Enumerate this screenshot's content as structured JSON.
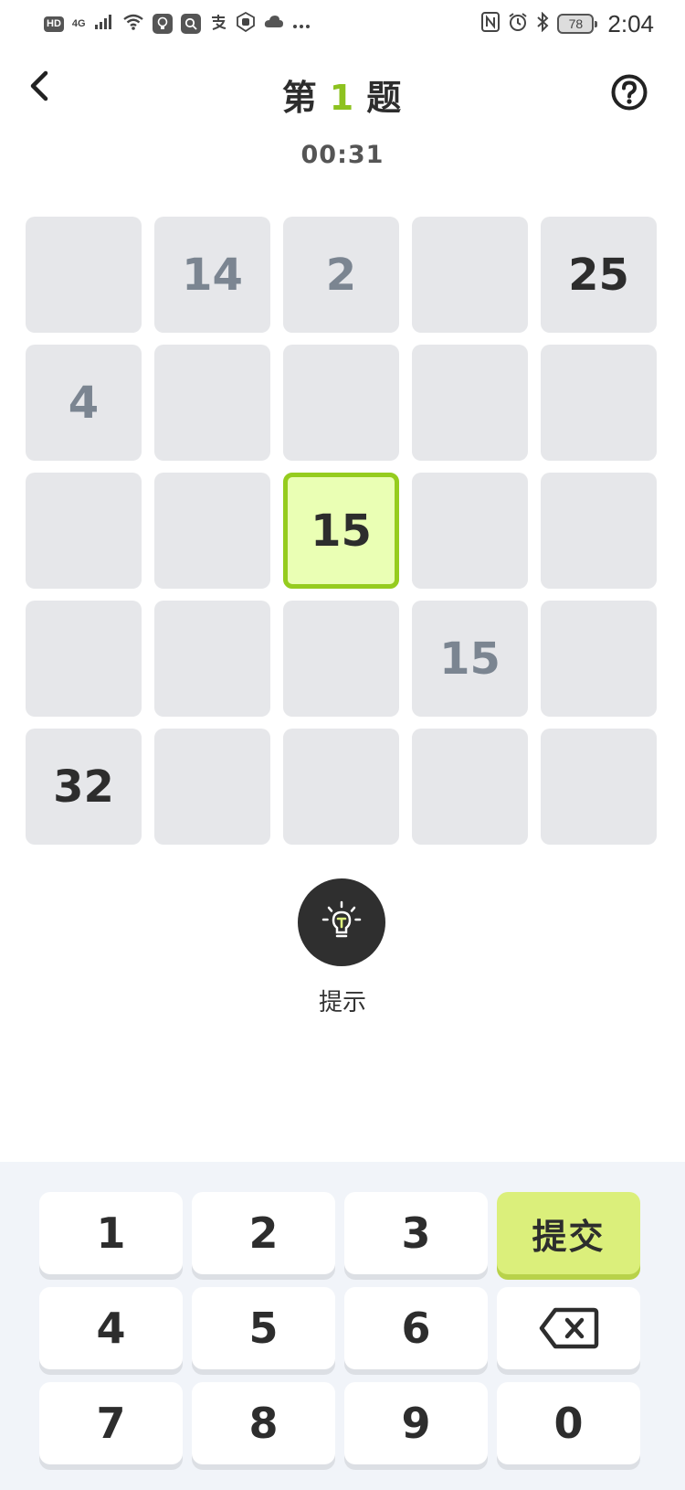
{
  "status_bar": {
    "hd": "HD",
    "network": "4G",
    "battery": "78",
    "time": "2:04"
  },
  "header": {
    "title_prefix": "第",
    "question_number": "1",
    "title_suffix": "题",
    "timer": "00:31"
  },
  "grid": {
    "rows": [
      [
        {
          "value": "",
          "kind": "empty"
        },
        {
          "value": "14",
          "kind": "user"
        },
        {
          "value": "2",
          "kind": "user"
        },
        {
          "value": "",
          "kind": "empty"
        },
        {
          "value": "25",
          "kind": "given"
        }
      ],
      [
        {
          "value": "4",
          "kind": "user"
        },
        {
          "value": "",
          "kind": "empty"
        },
        {
          "value": "",
          "kind": "empty"
        },
        {
          "value": "",
          "kind": "empty"
        },
        {
          "value": "",
          "kind": "empty"
        }
      ],
      [
        {
          "value": "",
          "kind": "empty"
        },
        {
          "value": "",
          "kind": "empty"
        },
        {
          "value": "15",
          "kind": "selected"
        },
        {
          "value": "",
          "kind": "empty"
        },
        {
          "value": "",
          "kind": "empty"
        }
      ],
      [
        {
          "value": "",
          "kind": "empty"
        },
        {
          "value": "",
          "kind": "empty"
        },
        {
          "value": "",
          "kind": "empty"
        },
        {
          "value": "15",
          "kind": "user"
        },
        {
          "value": "",
          "kind": "empty"
        }
      ],
      [
        {
          "value": "32",
          "kind": "given"
        },
        {
          "value": "",
          "kind": "empty"
        },
        {
          "value": "",
          "kind": "empty"
        },
        {
          "value": "",
          "kind": "empty"
        },
        {
          "value": "",
          "kind": "empty"
        }
      ]
    ]
  },
  "hint": {
    "label": "提示",
    "icon": "lightbulb-icon"
  },
  "keypad": {
    "keys": [
      {
        "label": "1",
        "type": "digit"
      },
      {
        "label": "2",
        "type": "digit"
      },
      {
        "label": "3",
        "type": "digit"
      },
      {
        "label": "提交",
        "type": "submit"
      },
      {
        "label": "4",
        "type": "digit"
      },
      {
        "label": "5",
        "type": "digit"
      },
      {
        "label": "6",
        "type": "digit"
      },
      {
        "label": "",
        "type": "backspace"
      },
      {
        "label": "7",
        "type": "digit"
      },
      {
        "label": "8",
        "type": "digit"
      },
      {
        "label": "9",
        "type": "digit"
      },
      {
        "label": "0",
        "type": "digit"
      }
    ]
  },
  "colors": {
    "accent": "#8dc21f",
    "selected_bg": "#eaffb4",
    "submit_bg": "#dbef7b",
    "cell_bg": "#e6e7ea",
    "user_digit": "#7b8591"
  }
}
